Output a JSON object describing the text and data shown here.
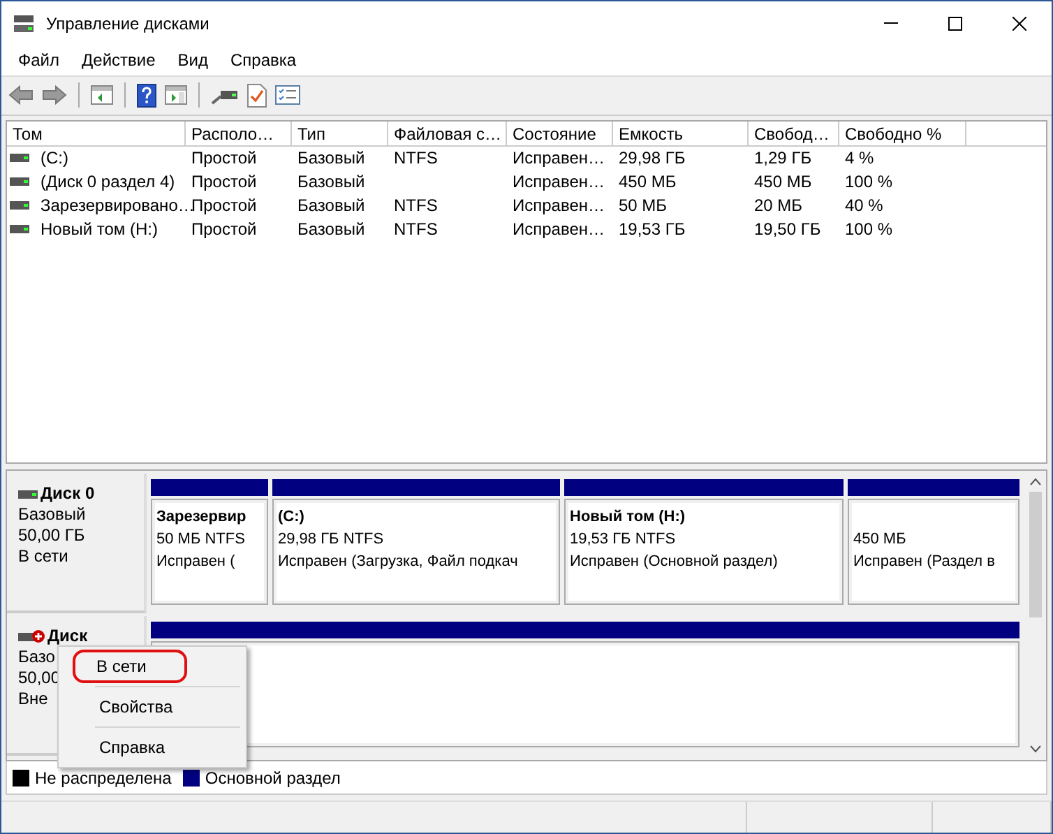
{
  "window": {
    "title": "Управление дисками"
  },
  "menu": [
    "Файл",
    "Действие",
    "Вид",
    "Справка"
  ],
  "volume_table": {
    "columns": [
      "Том",
      "Располо…",
      "Тип",
      "Файловая с…",
      "Состояние",
      "Емкость",
      "Свобод…",
      "Свободно %"
    ],
    "rows": [
      [
        "(C:)",
        "Простой",
        "Базовый",
        "NTFS",
        "Исправен…",
        "29,98 ГБ",
        "1,29 ГБ",
        "4 %"
      ],
      [
        "(Диск 0 раздел 4)",
        "Простой",
        "Базовый",
        "",
        "Исправен…",
        "450 МБ",
        "450 МБ",
        "100 %"
      ],
      [
        "Зарезервировано…",
        "Простой",
        "Базовый",
        "NTFS",
        "Исправен…",
        "50 МБ",
        "20 МБ",
        "40 %"
      ],
      [
        "Новый том (H:)",
        "Простой",
        "Базовый",
        "NTFS",
        "Исправен…",
        "19,53 ГБ",
        "19,50 ГБ",
        "100 %"
      ]
    ]
  },
  "disks": [
    {
      "name": "Диск 0",
      "online": true,
      "lines": [
        "Базовый",
        "50,00 ГБ",
        "В сети"
      ],
      "partitions": [
        {
          "color": "#000080",
          "name": "Зарезервир",
          "size": "50 МБ NTFS",
          "status": "Исправен ("
        },
        {
          "color": "#000080",
          "name": "(C:)",
          "size": "29,98 ГБ NTFS",
          "status": "Исправен (Загрузка, Файл подкач"
        },
        {
          "color": "#000080",
          "name": "Новый том  (H:)",
          "size": "19,53 ГБ NTFS",
          "status": "Исправен (Основной раздел)"
        },
        {
          "color": "#000080",
          "size": "450 МБ",
          "status": "Исправен (Раздел в"
        }
      ]
    },
    {
      "name": "Диск",
      "online": false,
      "lines": [
        "Базо",
        "50,00",
        "Вне"
      ],
      "partitions": [
        {
          "color": "#000080"
        }
      ]
    }
  ],
  "context_menu": [
    {
      "label": "В сети",
      "annotated": true
    },
    {
      "label": "Свойства",
      "annotated": false
    },
    {
      "label": "Справка",
      "annotated": false
    }
  ],
  "legend": [
    {
      "label": "Не распределена",
      "color": "#000000"
    },
    {
      "label": "Основной раздел",
      "color": "#000080"
    }
  ]
}
